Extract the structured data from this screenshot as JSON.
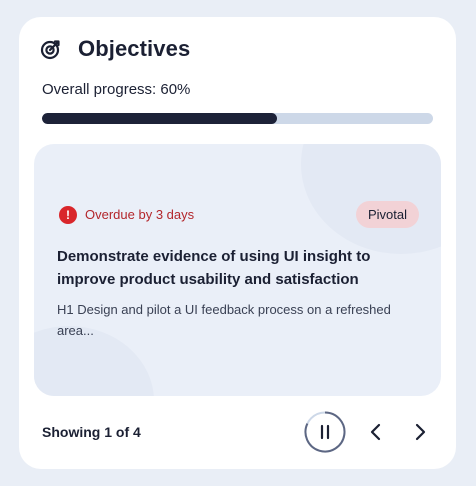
{
  "widget": {
    "title": "Objectives",
    "icon": "target-icon"
  },
  "progress": {
    "label": "Overall progress: 60%",
    "value": 0.6,
    "fill_color": "#1d2238",
    "track_color": "#cdd8e8"
  },
  "objective": {
    "status_icon": "alert-circle-icon",
    "status_text": "Overdue by 3 days",
    "status_color": "#d9262b",
    "badge": "Pivotal",
    "title": "Demonstrate evidence of using UI insight to improve product usability and satisfaction",
    "description": "H1 Design and pilot a UI feedback process on a refreshed area..."
  },
  "pagination": {
    "showing_text": "Showing 1 of 4",
    "pause_icon": "pause-icon",
    "prev_icon": "chevron-left-icon",
    "next_icon": "chevron-right-icon"
  }
}
